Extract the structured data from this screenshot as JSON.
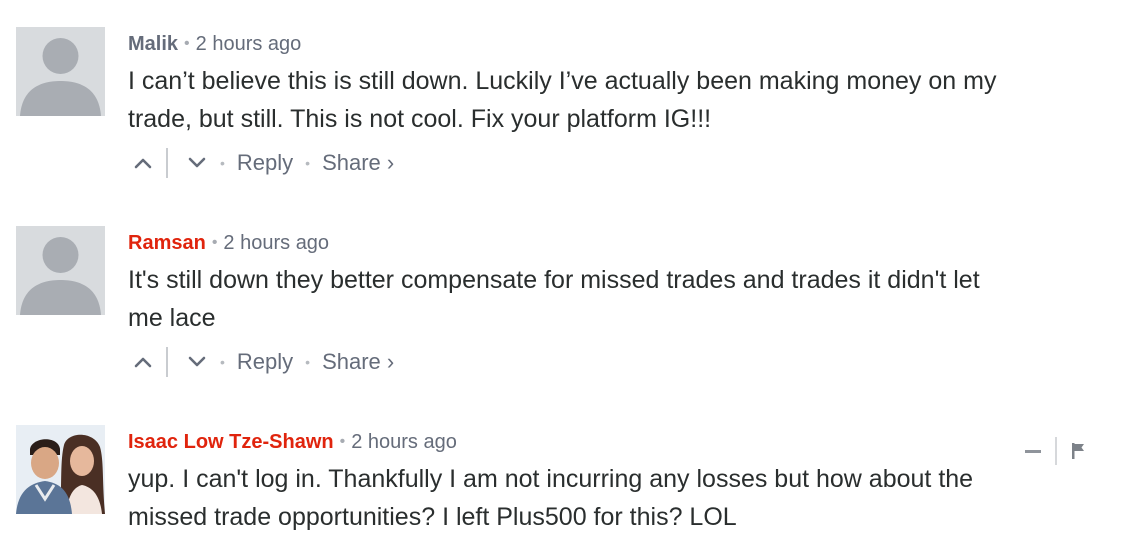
{
  "comments": [
    {
      "author": "Malik",
      "time": "2 hours ago",
      "text": "I can’t believe this is still down. Luckily I’ve actually been making money on my\ntrade, but still. This is not cool. Fix your platform IG!!!",
      "reply_label": "Reply",
      "share_label": "Share ›",
      "avatar": "default-avatar"
    },
    {
      "author": "Ramsan",
      "time": "2 hours ago",
      "text": "It's still down they better compensate for missed trades and trades it didn't let\nme lace",
      "reply_label": "Reply",
      "share_label": "Share ›",
      "avatar": "default-avatar"
    },
    {
      "author": "Isaac Low Tze-Shawn",
      "time": "2 hours ago",
      "text": "yup. I can't log in. Thankfully I am not incurring any losses but how about the\nmissed trade opportunities? I left Plus500 for this? LOL",
      "avatar": "photo-avatar"
    }
  ],
  "separator_bullet": "•",
  "colors": {
    "author_default": "#656c7a",
    "author_highlight": "#e0240d",
    "text": "#2a2e2e",
    "meta": "#656c7a",
    "avatar_bg": "#d8dbde",
    "avatar_fg": "#a9adb3"
  },
  "icons": [
    "upvote-icon",
    "downvote-icon",
    "minimize-icon",
    "flag-icon"
  ]
}
